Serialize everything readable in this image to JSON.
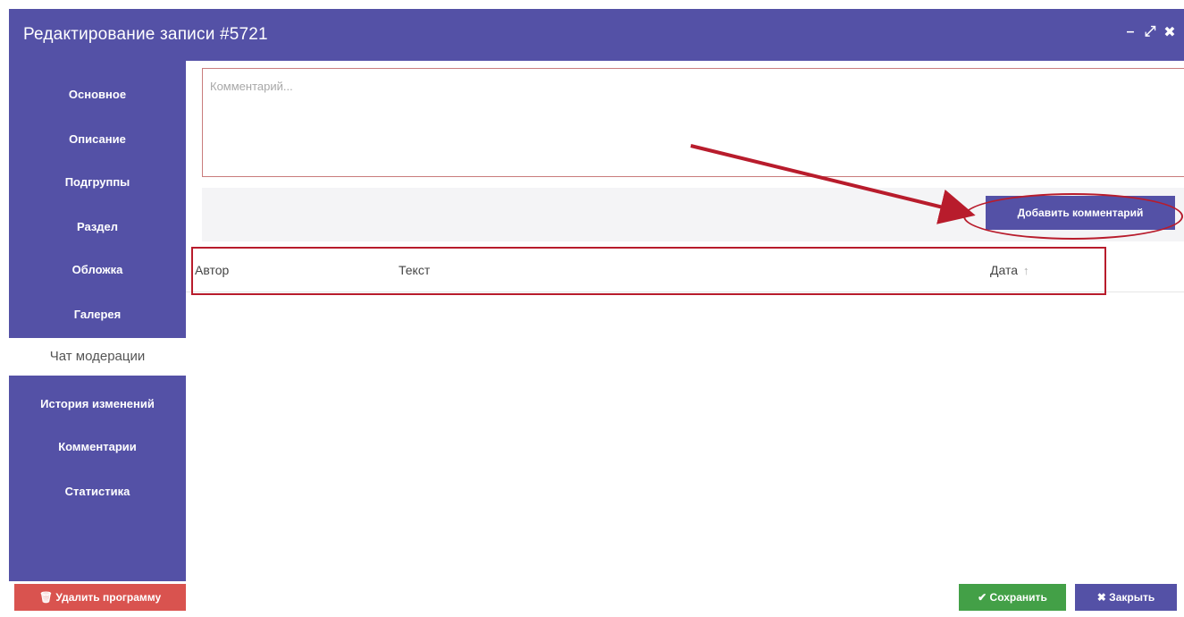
{
  "window": {
    "title": "Редактирование записи #5721",
    "controls": {
      "minimize": "–",
      "maximize": "⤢",
      "close": "✖"
    }
  },
  "sidebar": {
    "items": [
      {
        "label": "Основное",
        "active": false
      },
      {
        "label": "Описание",
        "active": false
      },
      {
        "label": "Подгруппы",
        "active": false
      },
      {
        "label": "Раздел",
        "active": false
      },
      {
        "label": "Обложка",
        "active": false
      },
      {
        "label": "Галерея",
        "active": false
      },
      {
        "label": "Чат модерации",
        "active": true
      },
      {
        "label": "История изменений",
        "active": false
      },
      {
        "label": "Комментарии",
        "active": false
      },
      {
        "label": "Статистика",
        "active": false
      }
    ]
  },
  "comment": {
    "placeholder": "Комментарий...",
    "value": ""
  },
  "add_button": {
    "label": "Добавить комментарий"
  },
  "table": {
    "columns": [
      {
        "label": "Автор"
      },
      {
        "label": "Текст"
      },
      {
        "label": "Дата",
        "sort_icon": "↑"
      }
    ],
    "rows": []
  },
  "footer": {
    "delete_label": "🗑 Удалить программу",
    "save_label": "✔ Сохранить",
    "close_label": "✖ Закрыть"
  },
  "colors": {
    "primary": "#5451a6",
    "danger": "#d9534f",
    "success": "#43a047",
    "annotation": "#b81c2c"
  }
}
